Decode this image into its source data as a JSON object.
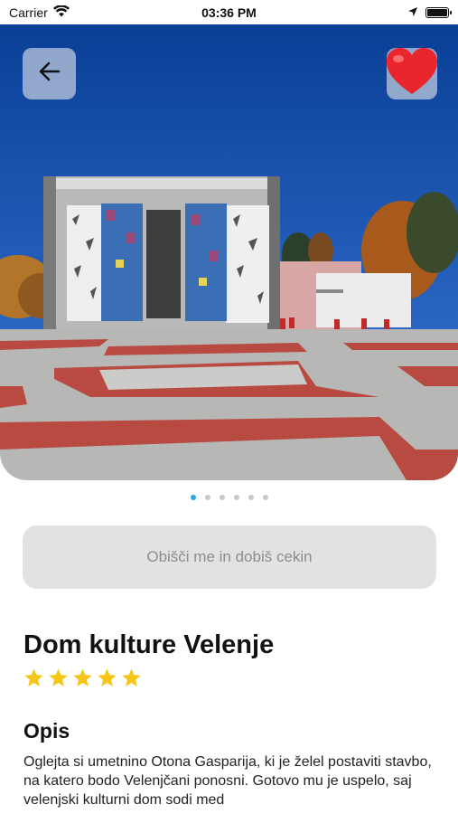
{
  "status_bar": {
    "carrier": "Carrier",
    "time": "03:36 PM"
  },
  "hero": {
    "image_description_icon": "building-photo",
    "carousel_page_count": 6,
    "carousel_active_index": 0
  },
  "colors": {
    "accent_dot": "#2aa4e8",
    "star": "#f5c518",
    "heart": "#e8262c",
    "button_bg": "#e2e2e2"
  },
  "cta": {
    "label": "Obišči me in dobiš cekin"
  },
  "place": {
    "title": "Dom kulture Velenje",
    "rating": 5,
    "rating_max": 5
  },
  "description": {
    "heading": "Opis",
    "text": "Oglejta si umetnino Otona Gasparija, ki je želel postaviti stavbo, na katero bodo Velenjčani ponosni. Gotovo mu je uspelo, saj velenjski kulturni dom sodi med"
  }
}
